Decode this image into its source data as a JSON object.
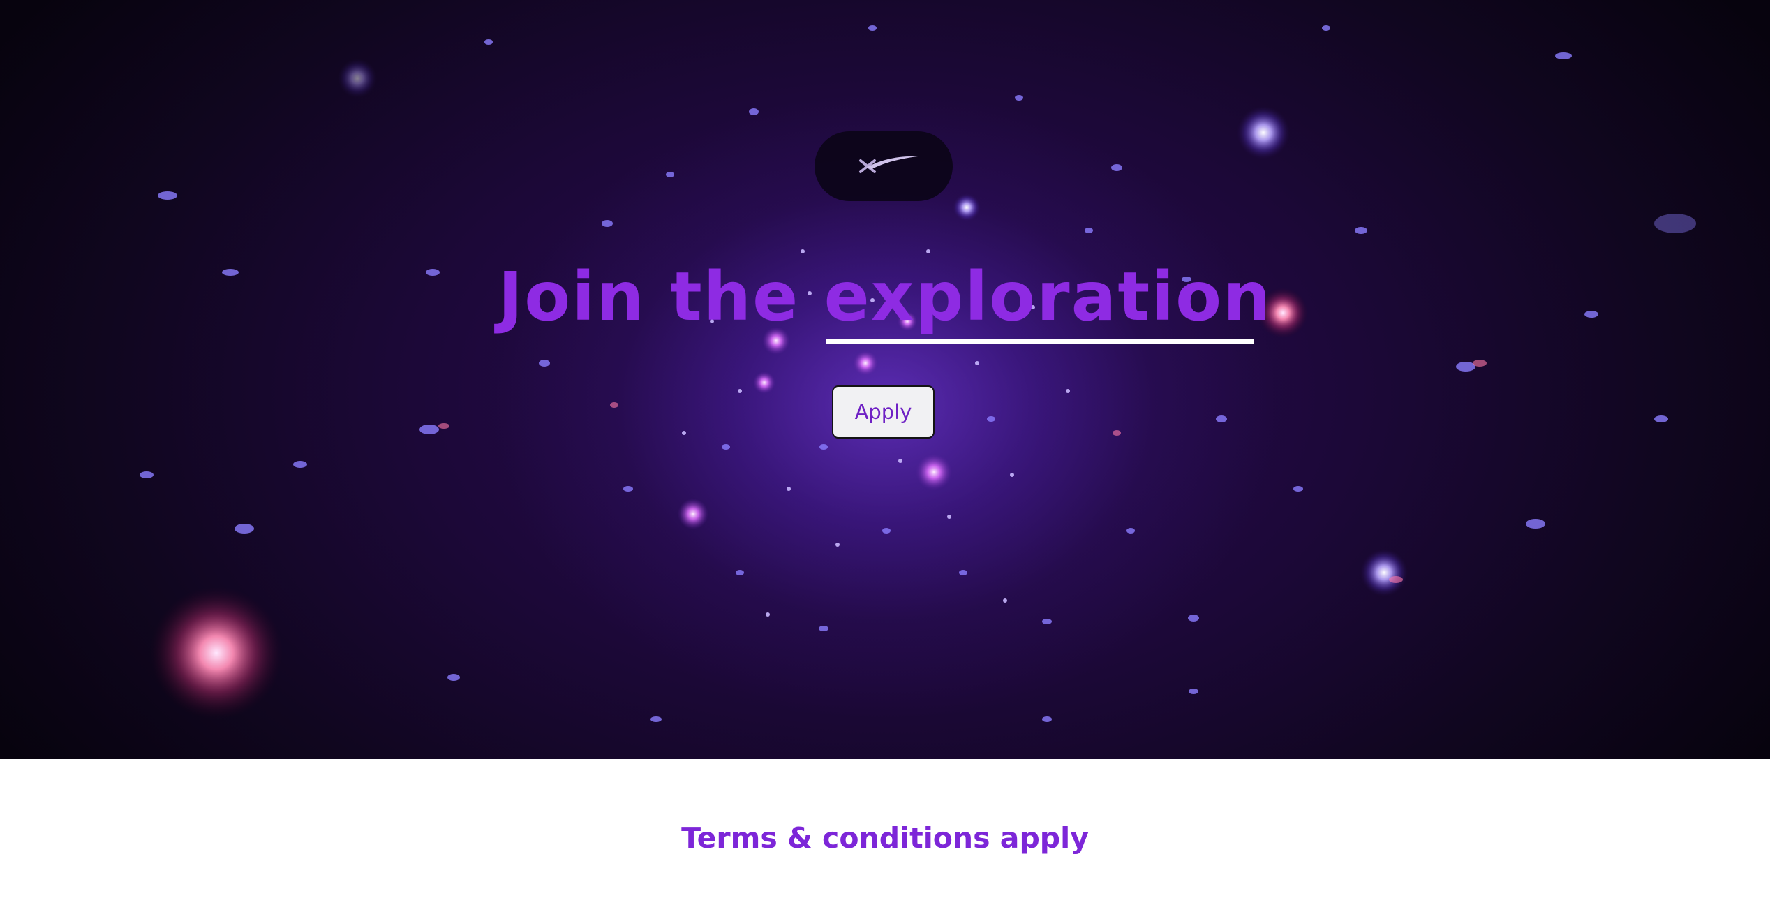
{
  "hero": {
    "logo_icon": "spacex-x-icon",
    "headline": "Join the exploration",
    "apply_label": "Apply"
  },
  "footer": {
    "terms_text": "Terms & conditions apply"
  },
  "colors": {
    "accent": "#8e2be3",
    "button_bg": "#f1f1f3",
    "button_text": "#6f21c4",
    "footer_bg": "#ffffff"
  }
}
